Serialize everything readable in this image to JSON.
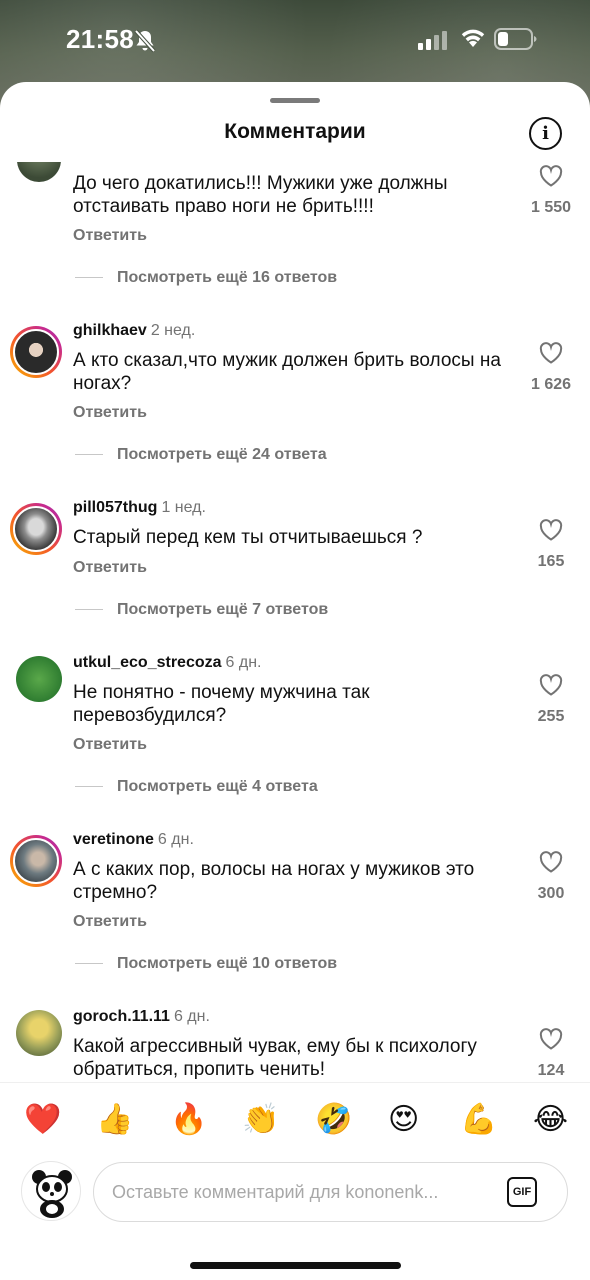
{
  "status_bar": {
    "time": "21:58"
  },
  "header": {
    "title": "Комментарии",
    "info_label": "i"
  },
  "comments": [
    {
      "username": "",
      "age": "",
      "text": "До чего докатились!!! Мужики уже должны отстаивать право ноги не брить!!!!",
      "reply": "Ответить",
      "likes": "1 550",
      "more": "Посмотреть ещё 16 ответов"
    },
    {
      "username": "ghilkhaev",
      "age": "2 нед.",
      "text": "А кто сказал,что мужик должен брить волосы на ногах?",
      "reply": "Ответить",
      "likes": "1 626",
      "more": "Посмотреть ещё 24 ответа"
    },
    {
      "username": "pill057thug",
      "age": "1 нед.",
      "text": "Старый перед кем ты отчитываешься ?",
      "reply": "Ответить",
      "likes": "165",
      "more": "Посмотреть ещё 7 ответов"
    },
    {
      "username": "utkul_eco_strecoza",
      "age": "6 дн.",
      "text": "Не понятно - почему мужчина так перевозбудился?",
      "reply": "Ответить",
      "likes": "255",
      "more": "Посмотреть ещё 4 ответа"
    },
    {
      "username": "veretinone",
      "age": "6 дн.",
      "text": "А с каких пор, волосы на ногах у мужиков это стремно?",
      "reply": "Ответить",
      "likes": "300",
      "more": "Посмотреть ещё 10 ответов"
    },
    {
      "username": "goroch.11.11",
      "age": "6 дн.",
      "text": "Какой агрессивный чувак, ему бы к психологу обратиться, пропить ченить!",
      "reply": "",
      "likes": "124",
      "more": ""
    }
  ],
  "reactions": [
    "❤️",
    "👍",
    "🔥",
    "👏",
    "🤣",
    "😍",
    "💪",
    "😂"
  ],
  "composer": {
    "placeholder": "Оставьте комментарий для kononenk...",
    "gif_label": "GIF"
  }
}
